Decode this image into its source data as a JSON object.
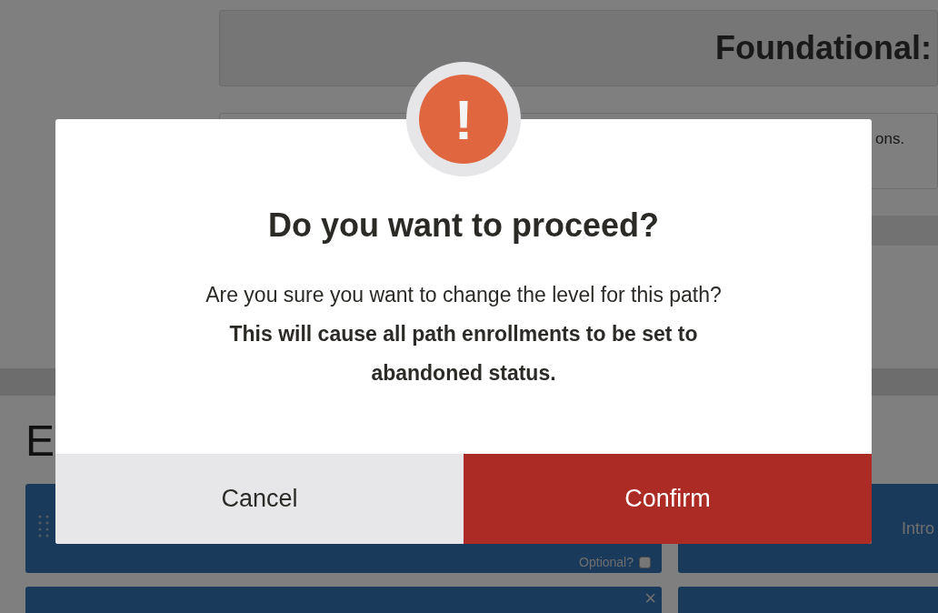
{
  "background": {
    "header_title": "Foundational:",
    "description": "ons.",
    "section_heading": "E",
    "cards": [
      {
        "kind": "drag",
        "optional_label": "Optional?",
        "optional_checked": false
      },
      {
        "kind": "titled",
        "title": "Intro"
      },
      {
        "kind": "removable",
        "close": "×"
      },
      {
        "kind": "plain"
      }
    ]
  },
  "dialog": {
    "icon": "!",
    "title": "Do you want to proceed?",
    "message": "Are you sure you want to change the level for this path? **This will cause all path enrollments to be set to abandoned status.**",
    "buttons": [
      {
        "kind": "cancel",
        "label": "Cancel"
      },
      {
        "kind": "confirm",
        "label": "Confirm"
      }
    ]
  }
}
